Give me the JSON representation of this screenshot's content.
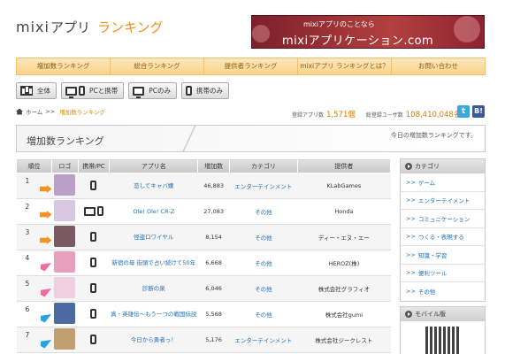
{
  "header": {
    "logo_brand": "mixi",
    "logo_brand2": "アプリ",
    "logo_accent": "ランキング",
    "banner_line1": "mixiアプリのことなら",
    "banner_line2": "mixiアプリケーション.com"
  },
  "nav": {
    "items": [
      "増加数ランキング",
      "総合ランキング",
      "提供者ランキング",
      "mixiアプリ ランキングとは？",
      "お問い合わせ"
    ]
  },
  "filters": [
    {
      "label": "全体",
      "icon": "bars-icon"
    },
    {
      "label": "PCと携帯",
      "icon": "pc-phone-icon"
    },
    {
      "label": "PCのみ",
      "icon": "pc-icon"
    },
    {
      "label": "携帯のみ",
      "icon": "phone-icon"
    }
  ],
  "breadcrumb": {
    "home": "ホーム",
    "separator": ">>",
    "current": "増加数ランキング"
  },
  "stats": {
    "apps_label": "登録アプリ数",
    "apps_value": "1,571個",
    "users_label": "総登録ユーザ数",
    "users_value": "108,410,048名"
  },
  "social": {
    "twitter": "t",
    "bookmark": "B!"
  },
  "section": {
    "title": "増加数ランキング",
    "subtitle": "今日の増加数ランキングです。"
  },
  "table": {
    "headers": [
      "順位",
      "ロゴ",
      "携帯/PC",
      "アプリ名",
      "増加数",
      "カテゴリ",
      "提供者"
    ],
    "rows": [
      {
        "rank": "1",
        "mark": "up",
        "thumb": "#b8a0c8",
        "device": "phone",
        "app": "恋してキャバ嬢",
        "inc": "46,883",
        "cat": "エンターテインメント",
        "prov": "KLabGames"
      },
      {
        "rank": "2",
        "mark": "up",
        "thumb": "#d8c8e0",
        "device": "pc-phone",
        "app": "Ole! Ole! CR-Z",
        "inc": "27,083",
        "cat": "その他",
        "prov": "Honda"
      },
      {
        "rank": "3",
        "mark": "up",
        "thumb": "#7a5a60",
        "device": "phone",
        "app": "怪盗ロワイヤル",
        "inc": "8,154",
        "cat": "その他",
        "prov": "ディー・エヌ・エー"
      },
      {
        "rank": "4",
        "mark": "in",
        "thumb": "#e8a0c0",
        "device": "phone",
        "app": "新宿の母 街頭で占い続けて50年",
        "inc": "6,668",
        "cat": "その他",
        "prov": "HEROZ(株)"
      },
      {
        "rank": "5",
        "mark": "in",
        "thumb": "#f0d0e0",
        "device": "phone",
        "app": "診断の泉",
        "inc": "6,046",
        "cat": "その他",
        "prov": "株式会社グラフィオ"
      },
      {
        "rank": "6",
        "mark": "st",
        "thumb": "#4a6aa0",
        "device": "phone",
        "app": "真・英雄伝～もう一つの戦国伝説",
        "inc": "5,568",
        "cat": "その他",
        "prov": "株式会社gumi"
      },
      {
        "rank": "7",
        "mark": "st",
        "thumb": "#c0a070",
        "device": "phone",
        "app": "今日から勇者っ！",
        "inc": "5,176",
        "cat": "エンターテインメント",
        "prov": "株式会社ジークレスト"
      }
    ]
  },
  "sidebar": {
    "category_title": "カテゴリ",
    "categories": [
      "ゲーム",
      "エンターテイメント",
      "コミュニケーション",
      "つくる・表現する",
      "知識・学習",
      "便利ツール",
      "その他"
    ],
    "mobile_title": "モバイル版",
    "item_prefix": ">>"
  }
}
